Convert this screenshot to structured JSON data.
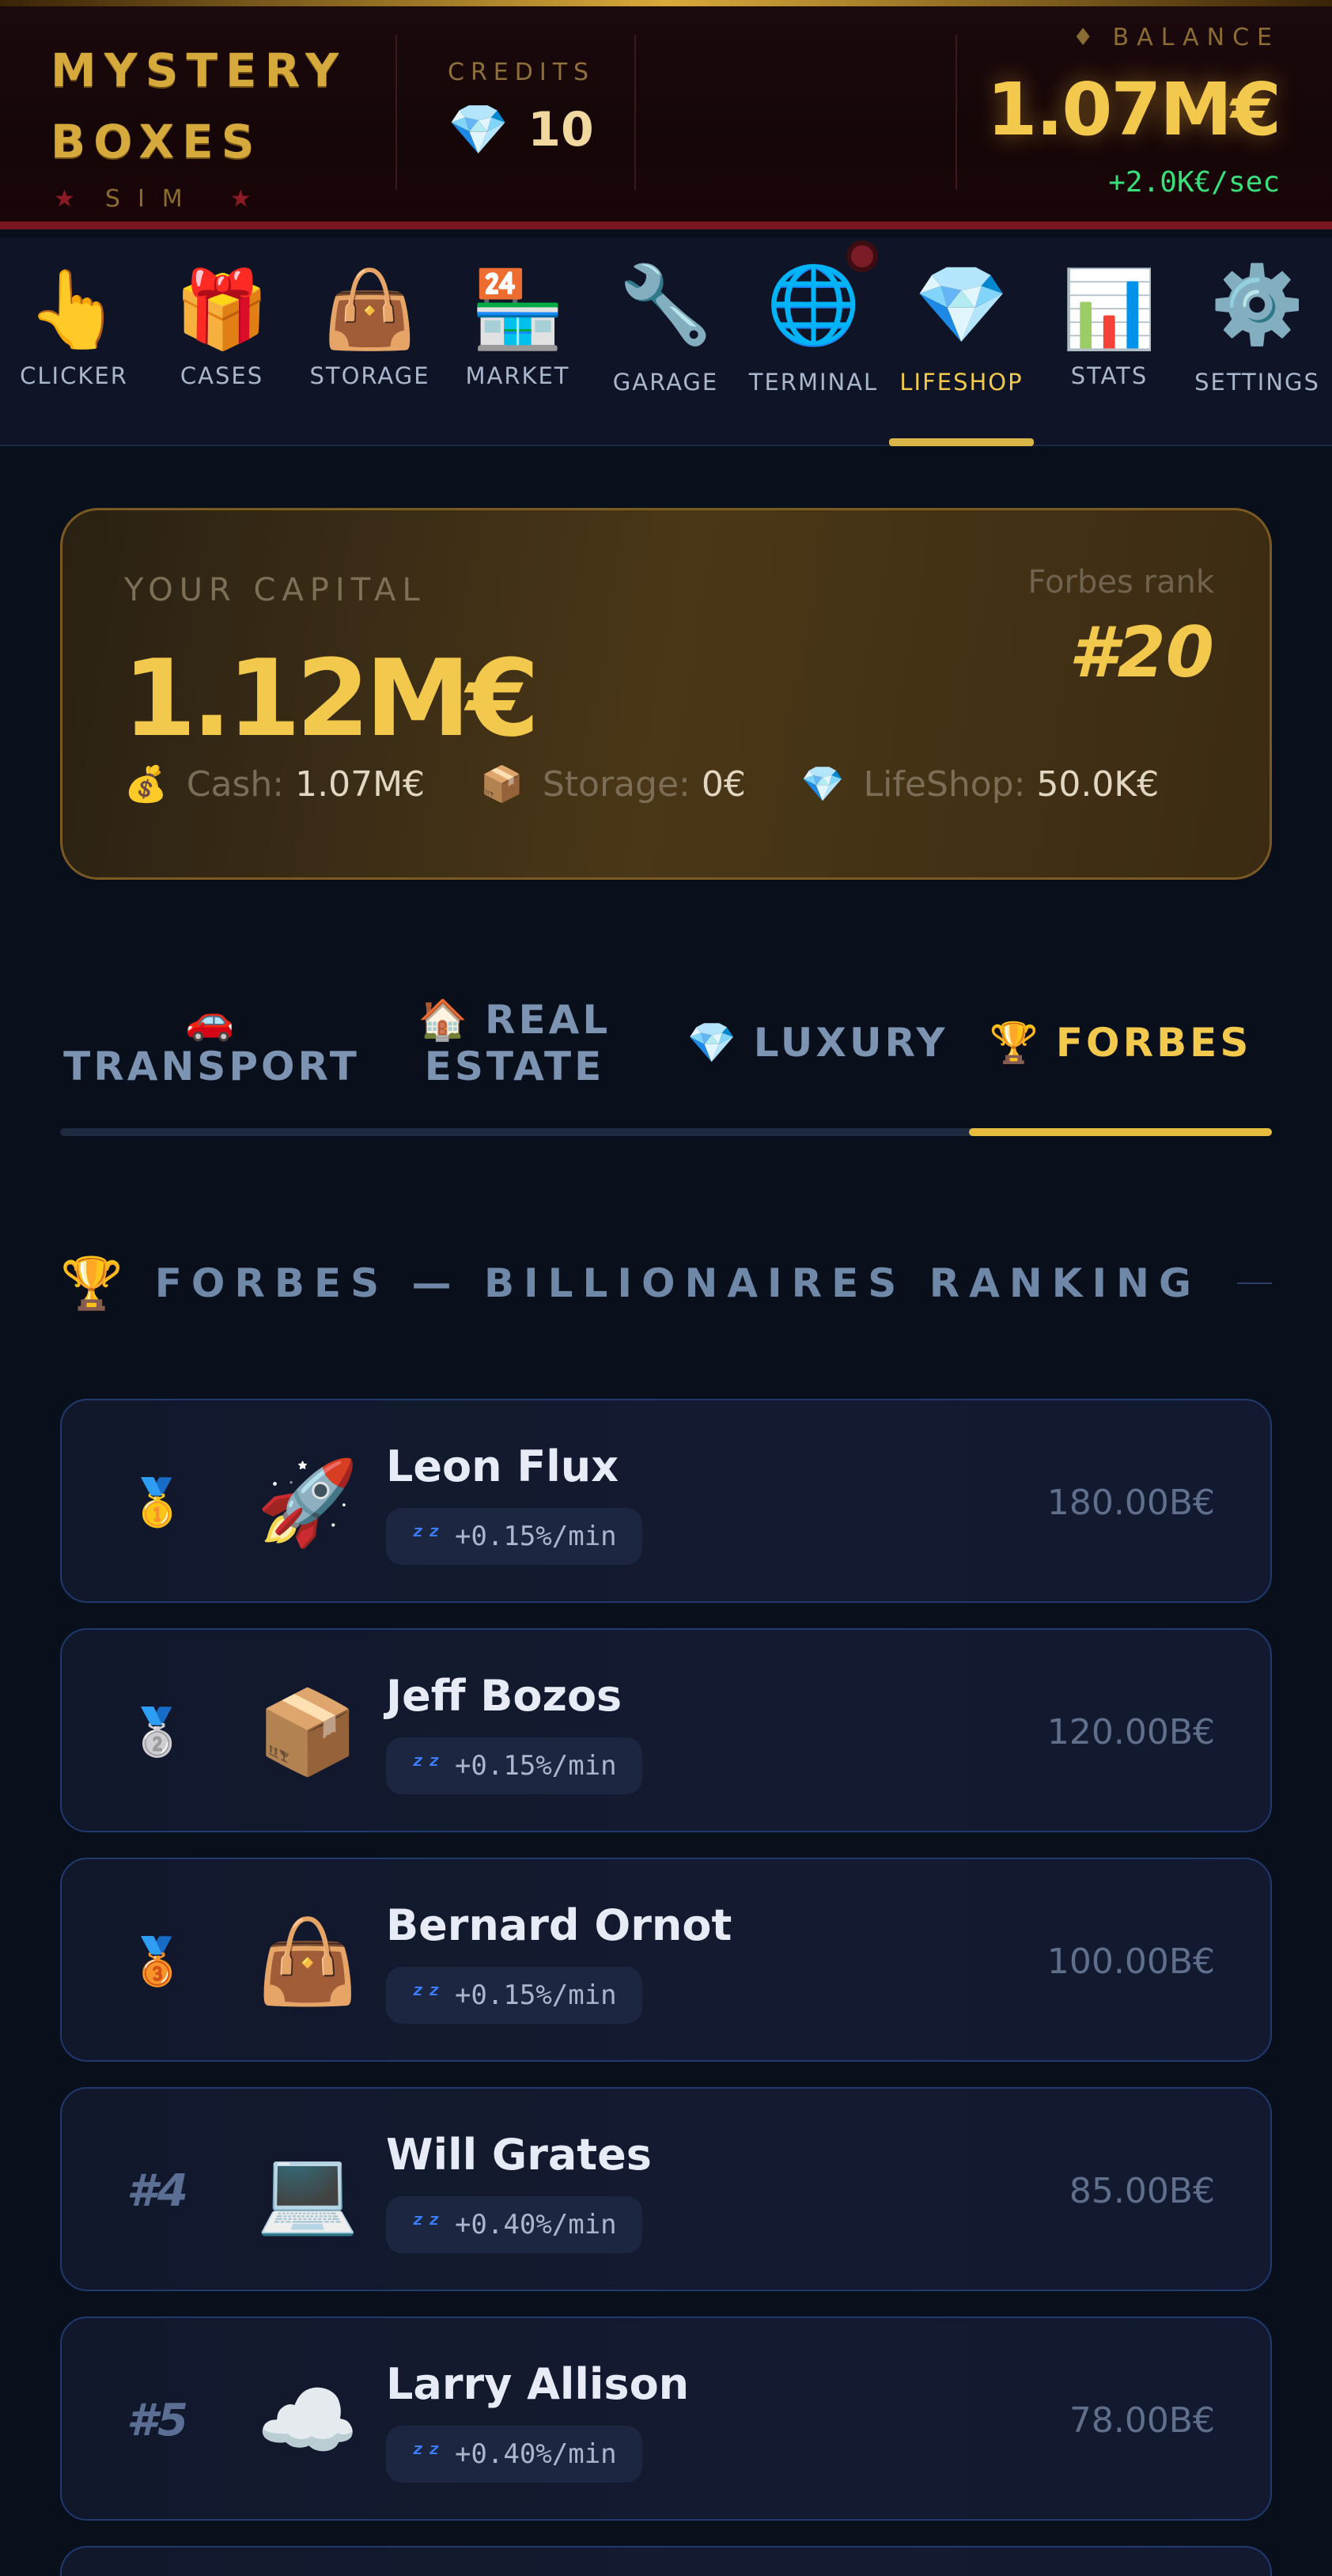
{
  "header": {
    "logo_line1": "MYSTERY",
    "logo_line2": "BOXES",
    "logo_sub": "SIM",
    "credits_label": "CREDITS",
    "credits_value": "10",
    "balance_label": "BALANCE",
    "balance_value": "1.07M€",
    "balance_rate": "+2.0K€/sec"
  },
  "nav": {
    "items": [
      {
        "label": "CLICKER",
        "icon": "clicker-icon"
      },
      {
        "label": "CASES",
        "icon": "gift-icon"
      },
      {
        "label": "STORAGE",
        "icon": "bag-icon"
      },
      {
        "label": "MARKET",
        "icon": "shop-icon"
      },
      {
        "label": "GARAGE",
        "icon": "wrench-icon"
      },
      {
        "label": "TERMINAL",
        "icon": "globe-icon"
      },
      {
        "label": "LIFESHOP",
        "icon": "diamond-icon"
      },
      {
        "label": "STATS",
        "icon": "chart-icon"
      },
      {
        "label": "SETTINGS",
        "icon": "gear-icon"
      }
    ],
    "active": "LIFESHOP"
  },
  "capital": {
    "label": "YOUR CAPITAL",
    "value": "1.12M€",
    "rank_label": "Forbes rank",
    "rank_value": "#20",
    "cash_label": "Cash:",
    "cash_value": "1.07M€",
    "storage_label": "Storage:",
    "storage_value": "0€",
    "lifeshop_label": "LifeShop:",
    "lifeshop_value": "50.0K€"
  },
  "tabs": {
    "transport": "TRANSPORT",
    "real_estate_1": "REAL",
    "real_estate_2": "ESTATE",
    "luxury": "LUXURY",
    "forbes": "FORBES",
    "active": "FORBES"
  },
  "section": {
    "title": "FORBES — BILLIONAIRES RANKING"
  },
  "ranking": [
    {
      "rank": "1",
      "name": "Leon Flux",
      "rate": "+0.15%/min",
      "worth": "180.00B€"
    },
    {
      "rank": "2",
      "name": "Jeff Bozos",
      "rate": "+0.15%/min",
      "worth": "120.00B€"
    },
    {
      "rank": "3",
      "name": "Bernard Ornot",
      "rate": "+0.15%/min",
      "worth": "100.00B€"
    },
    {
      "rank": "#4",
      "name": "Will Grates",
      "rate": "+0.40%/min",
      "worth": "85.00B€"
    },
    {
      "rank": "#5",
      "name": "Larry Allison",
      "rate": "+0.40%/min",
      "worth": "78.00B€"
    }
  ],
  "colors": {
    "accent_gold": "#f2c94c",
    "rate_green": "#39e07a",
    "brand_red": "#7a1620",
    "card_border": "#1f3a6e"
  }
}
